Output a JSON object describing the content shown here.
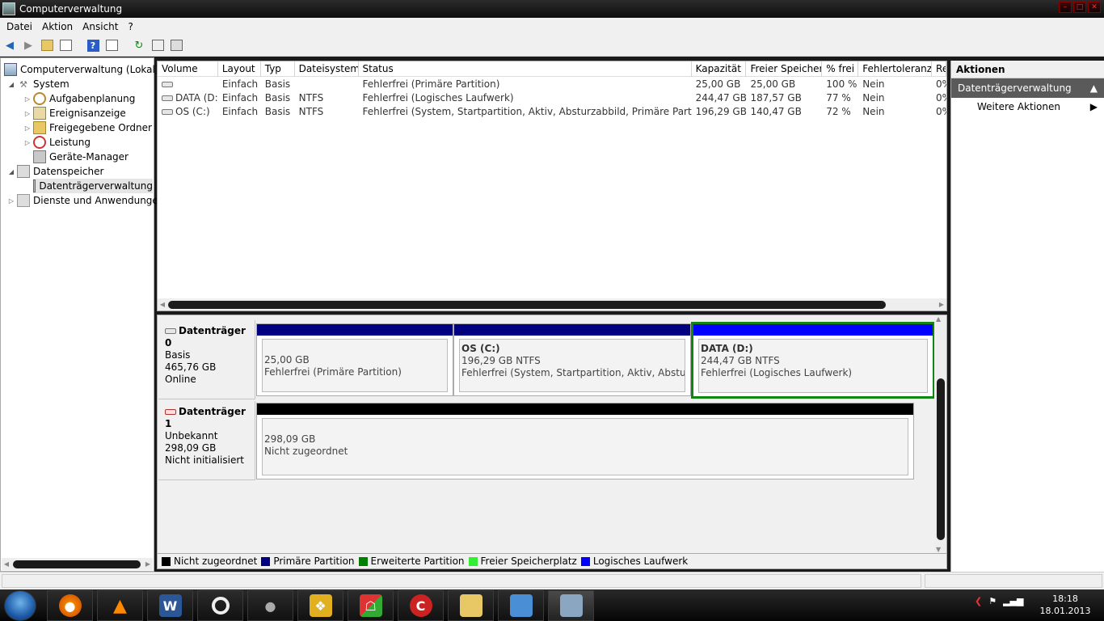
{
  "window": {
    "title": "Computerverwaltung"
  },
  "menu": [
    "Datei",
    "Aktion",
    "Ansicht",
    "?"
  ],
  "tree": {
    "root": "Computerverwaltung (Lokal)",
    "system": "System",
    "aufgaben": "Aufgabenplanung",
    "ereignis": "Ereignisanzeige",
    "freigabe": "Freigegebene Ordner",
    "leistung": "Leistung",
    "geraete": "Geräte-Manager",
    "datenspeicher": "Datenspeicher",
    "datentraeger": "Datenträgerverwaltung",
    "dienste": "Dienste und Anwendungen"
  },
  "columns": [
    "Volume",
    "Layout",
    "Typ",
    "Dateisystem",
    "Status",
    "Kapazität",
    "Freier Speicher",
    "% frei",
    "Fehlertoleranz",
    "Re"
  ],
  "volumes": [
    {
      "volume": "",
      "layout": "Einfach",
      "typ": "Basis",
      "fs": "",
      "status": "Fehlerfrei (Primäre Partition)",
      "kap": "25,00 GB",
      "frei": "25,00 GB",
      "pct": "100 %",
      "ft": "Nein",
      "re": "0%"
    },
    {
      "volume": "DATA (D:)",
      "layout": "Einfach",
      "typ": "Basis",
      "fs": "NTFS",
      "status": "Fehlerfrei (Logisches Laufwerk)",
      "kap": "244,47 GB",
      "frei": "187,57 GB",
      "pct": "77 %",
      "ft": "Nein",
      "re": "0%"
    },
    {
      "volume": "OS (C:)",
      "layout": "Einfach",
      "typ": "Basis",
      "fs": "NTFS",
      "status": "Fehlerfrei (System, Startpartition, Aktiv, Absturzabbild, Primäre Partition)",
      "kap": "196,29 GB",
      "frei": "140,47 GB",
      "pct": "72 %",
      "ft": "Nein",
      "re": "0%"
    }
  ],
  "disk0": {
    "name": "Datenträger 0",
    "type": "Basis",
    "size": "465,76 GB",
    "state": "Online",
    "p1": {
      "size": "25,00 GB",
      "status": "Fehlerfrei (Primäre Partition)"
    },
    "p2": {
      "name": "OS  (C:)",
      "size": "196,29 GB NTFS",
      "status": "Fehlerfrei (System, Startpartition, Aktiv, Absturzabb"
    },
    "p3": {
      "name": "DATA  (D:)",
      "size": "244,47 GB NTFS",
      "status": "Fehlerfrei (Logisches Laufwerk)"
    }
  },
  "disk1": {
    "name": "Datenträger 1",
    "type": "Unbekannt",
    "size": "298,09 GB",
    "state": "Nicht initialisiert",
    "p1": {
      "size": "298,09 GB",
      "status": "Nicht zugeordnet"
    }
  },
  "legend": [
    {
      "label": "Nicht zugeordnet",
      "color": "#000000"
    },
    {
      "label": "Primäre Partition",
      "color": "#000080"
    },
    {
      "label": "Erweiterte Partition",
      "color": "#008000"
    },
    {
      "label": "Freier Speicherplatz",
      "color": "#33ee33"
    },
    {
      "label": "Logisches Laufwerk",
      "color": "#0000ff"
    }
  ],
  "actions": {
    "title": "Aktionen",
    "section": "Datenträgerverwaltung",
    "more": "Weitere Aktionen"
  },
  "clock": {
    "time": "18:18",
    "date": "18.01.2013"
  }
}
